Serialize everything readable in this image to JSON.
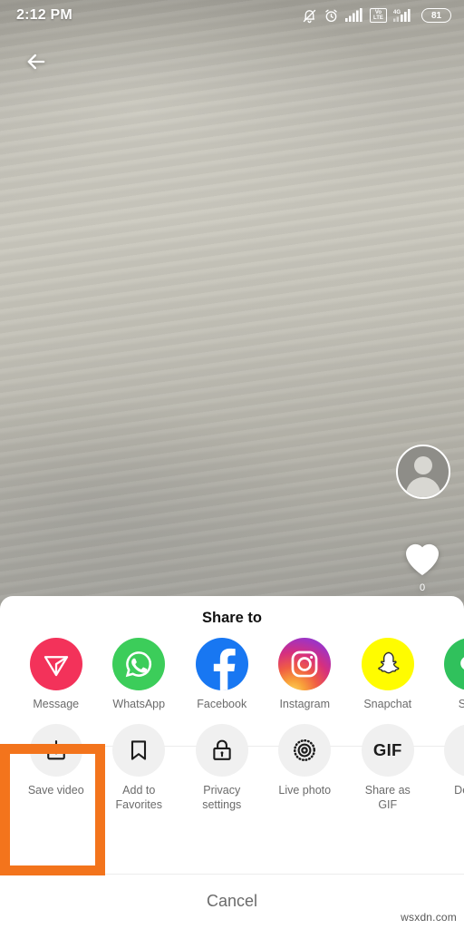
{
  "status_bar": {
    "time": "2:12 PM",
    "battery_level": "81",
    "volte_top": "Vo",
    "volte_bottom": "LTE",
    "network_label": "4G",
    "icons": [
      "bell-muted-icon",
      "alarm-clock-icon",
      "signal-bars-icon",
      "volte-icon",
      "signal-bars-4g-icon",
      "battery-icon"
    ]
  },
  "video": {
    "back_icon": "back-arrow-icon",
    "avatar_icon": "avatar-icon",
    "like_icon": "heart-icon",
    "like_count": "0"
  },
  "share_sheet": {
    "title": "Share to",
    "cancel_label": "Cancel",
    "highlight_color": "#f3741c",
    "share_targets": [
      {
        "label": "Message",
        "icon": "message-icon",
        "color": "#f3325a"
      },
      {
        "label": "WhatsApp",
        "icon": "whatsapp-icon",
        "color": "#3ccd5a"
      },
      {
        "label": "Facebook",
        "icon": "facebook-icon",
        "color": "#1877f2"
      },
      {
        "label": "Instagram",
        "icon": "instagram-icon",
        "color": "#d62f7e"
      },
      {
        "label": "Snapchat",
        "icon": "snapchat-icon",
        "color": "#fffc00"
      },
      {
        "label": "SMS",
        "icon": "sms-icon",
        "color": "#30c15c"
      }
    ],
    "actions": [
      {
        "label": "Save video",
        "icon": "download-icon",
        "highlighted": true
      },
      {
        "label": "Add to\nFavorites",
        "icon": "bookmark-icon",
        "highlighted": false
      },
      {
        "label": "Privacy\nsettings",
        "icon": "lock-icon",
        "highlighted": false
      },
      {
        "label": "Live photo",
        "icon": "live-photo-icon",
        "highlighted": false
      },
      {
        "label": "Share as\nGIF",
        "icon": "gif-icon",
        "highlighted": false
      },
      {
        "label": "Delete",
        "icon": "trash-icon",
        "highlighted": false
      }
    ]
  },
  "watermark": "wsxdn.com"
}
